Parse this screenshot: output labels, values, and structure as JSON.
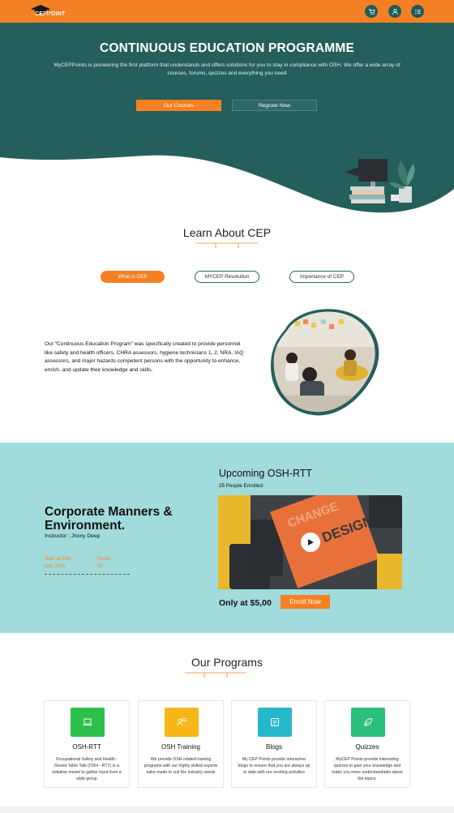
{
  "header": {
    "logo_text": "CEPPOINT",
    "icons": [
      "cart-icon",
      "user-icon",
      "menu-list-icon"
    ]
  },
  "hero": {
    "title": "CONTINUOUS EDUCATION PROGRAMME",
    "description": "MyCEPPoints is pioneering the first platform that understands and offers solutions for you to stay in compliance with OSH. We offer a wide array of courses, forums, quizzes and everything you need",
    "primary_button": "Our Courses",
    "secondary_button": "Register Now"
  },
  "learn": {
    "title": "Learn About CEP",
    "tabs": [
      "What is CEP",
      "MYCEP Revolution",
      "Importance of CEP"
    ],
    "active_tab": 0,
    "text": "Our “Continuous Education Program” was specifically created to provide personnel like safety and health officers, CHRA assessors, hygiene technicians 1, 2, NRA, IAQ assessors, and major hazards competent persons with the opportunity to enhance, enrich, and update their knowledge and skills."
  },
  "upcoming": {
    "course_title": "Corporate Manners & Environment.",
    "instructor": "Instructor : Jhony Deep",
    "start_label": "Start at 20th",
    "start_date": "Dec 2022",
    "points_label": "Points",
    "points_value": "05",
    "section_title": "Upcoming OSH-RTT",
    "enrolled": "25 People Enrolled",
    "price": "Only at $5,00",
    "enroll_button": "Enroll Now"
  },
  "programs": {
    "title": "Our Programs",
    "cards": [
      {
        "title": "OSH-RTT",
        "text": "Occupational Safety and Health - Round Table Talk (OSH - RTT) is a initiative meant to gather input from a wide group",
        "color": "#2ec04a",
        "icon": "laptop-icon"
      },
      {
        "title": "OSH Training",
        "text": "We provide OSH related training programs with our highly skilled experts tailor made to suit the industry needs",
        "color": "#f7b718",
        "icon": "trainer-icon"
      },
      {
        "title": "Blogs",
        "text": "My CEP Points provide interactive blogs to ensure that you are always up to date with our exciting activities",
        "color": "#26b7c9",
        "icon": "document-icon"
      },
      {
        "title": "Quizzes",
        "text": "MyCEP Points-provide interesting quizzes to gain your knowledge and make you more understandable about the topics.",
        "color": "#2bc07a",
        "icon": "leaf-icon"
      }
    ]
  },
  "colors": {
    "brand_orange": "#f58023",
    "hero_teal": "#245f5c",
    "upcoming_bg": "#a1dbdc"
  }
}
